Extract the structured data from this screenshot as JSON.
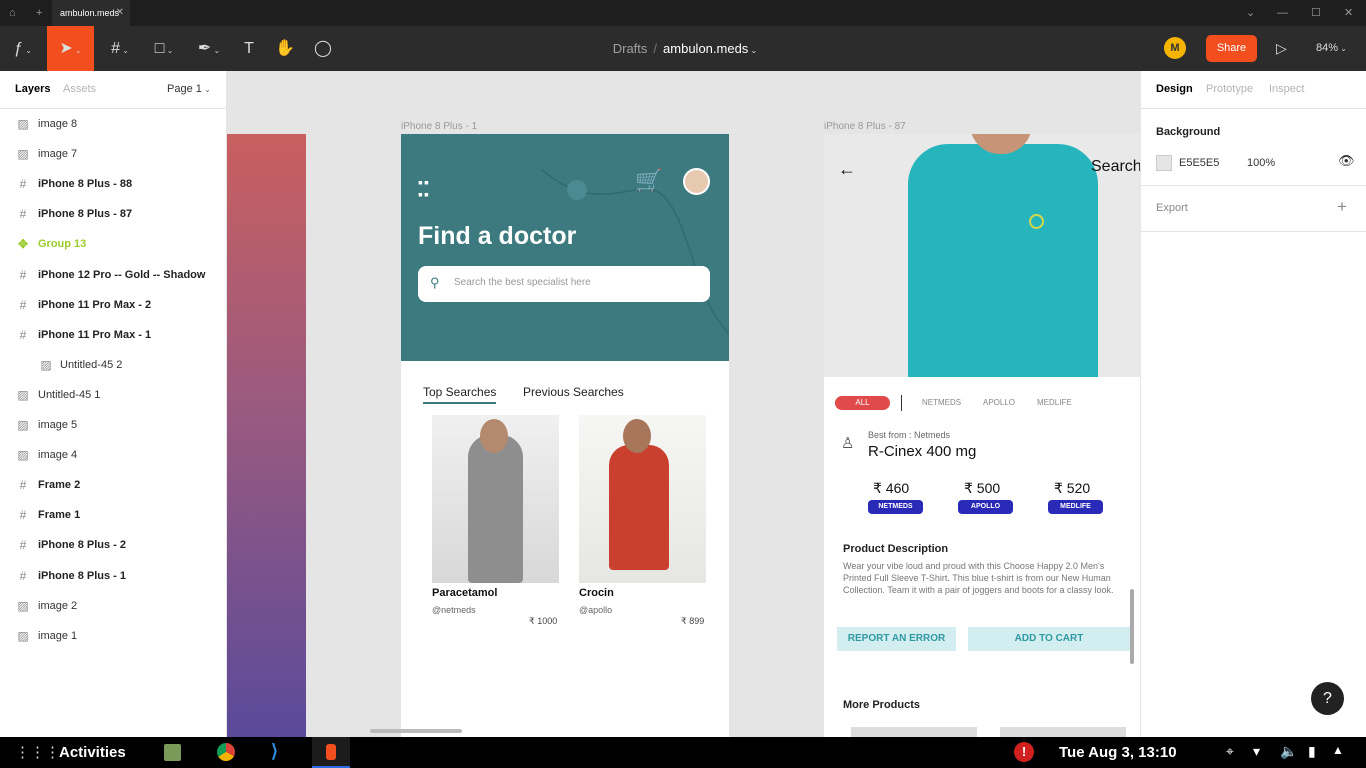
{
  "titlebar": {
    "tab_label": "ambulon.meds",
    "home_icon": "home-icon",
    "add_tab": "+",
    "close_tab": "✕"
  },
  "toolbar": {
    "breadcrumb_drafts": "Drafts",
    "breadcrumb_sep": "/",
    "file_name": "ambulon.meds",
    "avatar_initial": "M",
    "share_label": "Share",
    "zoom": "84%",
    "accent": "#f24e1e"
  },
  "left_panel": {
    "tabs": [
      "Layers",
      "Assets"
    ],
    "page": "Page 1",
    "layers": [
      {
        "name": "image 8",
        "icon": "image-icon",
        "kind": "image"
      },
      {
        "name": "image 7",
        "icon": "image-icon",
        "kind": "image"
      },
      {
        "name": "iPhone 8 Plus - 88",
        "icon": "frame-icon",
        "kind": "frame"
      },
      {
        "name": "iPhone 8 Plus - 87",
        "icon": "frame-icon",
        "kind": "frame"
      },
      {
        "name": "Group 13",
        "icon": "component-icon",
        "kind": "group"
      },
      {
        "name": "iPhone 12 Pro -- Gold -- Shadow",
        "icon": "frame-icon",
        "kind": "frame"
      },
      {
        "name": "iPhone 11 Pro Max - 2",
        "icon": "frame-icon",
        "kind": "frame"
      },
      {
        "name": "iPhone 11 Pro Max - 1",
        "icon": "frame-icon",
        "kind": "frame"
      },
      {
        "name": "Untitled-45 2",
        "icon": "image-icon",
        "kind": "child"
      },
      {
        "name": "Untitled-45 1",
        "icon": "image-icon",
        "kind": "image"
      },
      {
        "name": "image 5",
        "icon": "image-icon",
        "kind": "image"
      },
      {
        "name": "image 4",
        "icon": "image-icon",
        "kind": "image"
      },
      {
        "name": "Frame 2",
        "icon": "frame-icon",
        "kind": "frame"
      },
      {
        "name": "Frame 1",
        "icon": "frame-icon",
        "kind": "frame"
      },
      {
        "name": "iPhone 8 Plus - 2",
        "icon": "frame-icon",
        "kind": "frame"
      },
      {
        "name": "iPhone 8 Plus - 1",
        "icon": "frame-icon",
        "kind": "frame"
      },
      {
        "name": "image 2",
        "icon": "image-icon",
        "kind": "image"
      },
      {
        "name": "image 1",
        "icon": "image-icon",
        "kind": "image"
      }
    ]
  },
  "right_panel": {
    "tabs": [
      "Design",
      "Prototype",
      "Inspect"
    ],
    "background_title": "Background",
    "bg_hex": "E5E5E5",
    "bg_opacity": "100%",
    "export_title": "Export",
    "add": "+"
  },
  "canvas": {
    "frame1_label": "iPhone 8 Plus - 1",
    "frame87_label": "iPhone 8 Plus - 87",
    "frame1": {
      "title": "Find a doctor",
      "search_placeholder": "Search the best specialist here",
      "tab_top": "Top Searches",
      "tab_prev": "Previous Searches",
      "cards": [
        {
          "name": "Paracetamol",
          "handle": "@netmeds",
          "price": "₹ 1000"
        },
        {
          "name": "Crocin",
          "handle": "@apollo",
          "price": "₹ 899"
        }
      ]
    },
    "frame87": {
      "search": "Search",
      "filters": [
        "ALL",
        "NETMEDS",
        "APOLLO",
        "MEDLIFE"
      ],
      "best_from": "Best from : Netmeds",
      "product": "R-Cinex 400 mg",
      "prices": [
        {
          "price": "₹ 460",
          "store": "NETMEDS"
        },
        {
          "price": "₹ 500",
          "store": "APOLLO"
        },
        {
          "price": "₹ 520",
          "store": "MEDLIFE"
        }
      ],
      "desc_title": "Product Description",
      "desc": "Wear your vibe loud and proud with this Choose Happy 2.0 Men's Printed Full Sleeve T-Shirt. This blue t-shirt is from our New Human Collection. Team it with a pair of joggers and boots for a classy look.",
      "report": "REPORT AN ERROR",
      "cart": "ADD TO CART",
      "more": "More Products"
    }
  },
  "help": "?",
  "taskbar": {
    "activities": "Activities",
    "clock": "Tue Aug  3, 13:10"
  }
}
